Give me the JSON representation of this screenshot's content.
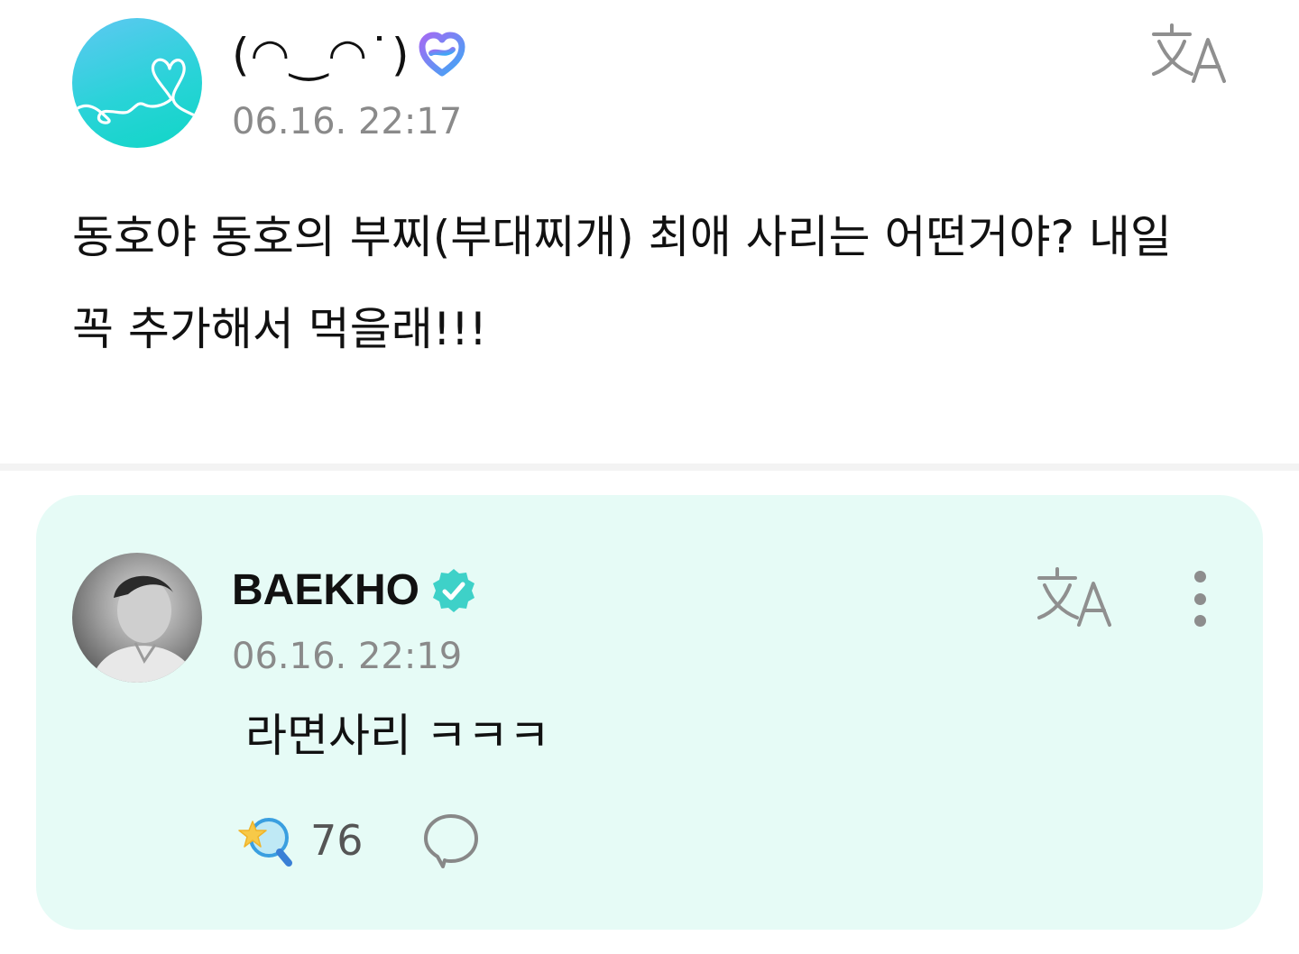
{
  "post": {
    "author_name": "(◠‿◠˙)",
    "membership_badge_icon": "membership-heart-icon",
    "timestamp": "06.16. 22:17",
    "translate_icon": "translate-icon",
    "text": "동호야 동호의 부찌(부대찌개) 최애 사리는 어떤거야? 내일 꼭 추가해서 먹을래!!!"
  },
  "reply": {
    "author_name": "BAEKHO",
    "verified_badge_icon": "verified-icon",
    "timestamp": "06.16. 22:19",
    "translate_icon": "translate-icon",
    "more_icon": "more-vertical-icon",
    "text": "라면사리 ㅋㅋㅋ",
    "like_icon": "star-wand-like-icon",
    "like_count": "76",
    "comment_icon": "comment-bubble-icon"
  },
  "colors": {
    "reply_background": "#e6fbf6",
    "verified_badge": "#3ed1c8",
    "timestamp": "#8a8a8a",
    "fan_avatar_gradient_start": "#5ec8f2",
    "fan_avatar_gradient_end": "#10d6c6"
  }
}
